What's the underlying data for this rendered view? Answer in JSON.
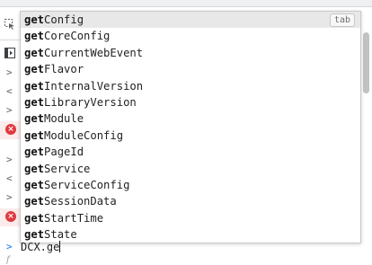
{
  "autocomplete": {
    "typed_prefix": "get",
    "tab_hint": "tab",
    "items": [
      {
        "match": "get",
        "rest": "Config"
      },
      {
        "match": "get",
        "rest": "CoreConfig"
      },
      {
        "match": "get",
        "rest": "CurrentWebEvent"
      },
      {
        "match": "get",
        "rest": "Flavor"
      },
      {
        "match": "get",
        "rest": "InternalVersion"
      },
      {
        "match": "get",
        "rest": "LibraryVersion"
      },
      {
        "match": "get",
        "rest": "Module"
      },
      {
        "match": "get",
        "rest": "ModuleConfig"
      },
      {
        "match": "get",
        "rest": "PageId"
      },
      {
        "match": "get",
        "rest": "Service"
      },
      {
        "match": "get",
        "rest": "ServiceConfig"
      },
      {
        "match": "get",
        "rest": "SessionData"
      },
      {
        "match": "get",
        "rest": "StartTime"
      },
      {
        "match": "get",
        "rest": "State"
      }
    ]
  },
  "console": {
    "prompt_symbol": ">",
    "input_value": "DCX.ge",
    "eval_glyph": "f",
    "gutter_arrow": ">",
    "gutter_back_arrow": "<",
    "error_symbol": "×"
  },
  "colors": {
    "error": "#e0393e",
    "prompt": "#1a73e8",
    "selected_row": "#e8e8e8"
  }
}
